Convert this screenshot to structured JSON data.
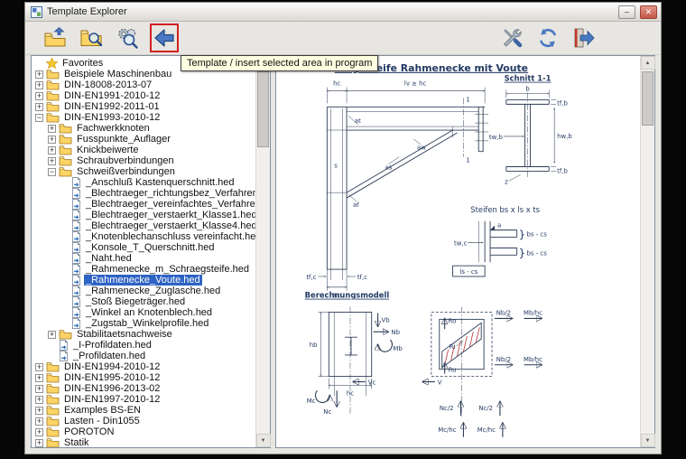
{
  "window": {
    "title": "Template Explorer"
  },
  "titlebar_icons": {
    "minimize": "–",
    "close": "✕"
  },
  "scrollbar_icons": {
    "up": "▲",
    "down": "▼"
  },
  "toolbar": {
    "tooltip": "Template / insert selected area in program",
    "button_names": [
      "open-template",
      "find-template",
      "search-options",
      "insert-template-into-program",
      "settings-tools",
      "refresh",
      "exit"
    ]
  },
  "colors": {
    "selection_blue": "#2e63c4",
    "tooltip_bg": "#ffffe1",
    "highlight_red": "#d22020",
    "drawing_line": "#2b3a55",
    "hatch_red": "#b03030",
    "folder_yellow": "#fcd364"
  },
  "tree": {
    "items": [
      {
        "label": "Favorites",
        "level": 0,
        "icon": "star",
        "toggle": "none"
      },
      {
        "label": "Beispiele Maschinenbau",
        "level": 0,
        "icon": "folder",
        "toggle": "plus"
      },
      {
        "label": "DIN-18008-2013-07",
        "level": 0,
        "icon": "folder",
        "toggle": "plus"
      },
      {
        "label": "DIN-EN1991-2010-12",
        "level": 0,
        "icon": "folder",
        "toggle": "plus"
      },
      {
        "label": "DIN-EN1992-2011-01",
        "level": 0,
        "icon": "folder",
        "toggle": "plus"
      },
      {
        "label": "DIN-EN1993-2010-12",
        "level": 0,
        "icon": "folder",
        "toggle": "minus"
      },
      {
        "label": "Fachwerkknoten",
        "level": 1,
        "icon": "folder",
        "toggle": "plus"
      },
      {
        "label": "Fusspunkte_Auflager",
        "level": 1,
        "icon": "folder",
        "toggle": "plus"
      },
      {
        "label": "Knickbeiwerte",
        "level": 1,
        "icon": "folder",
        "toggle": "plus"
      },
      {
        "label": "Schraubverbindungen",
        "level": 1,
        "icon": "folder",
        "toggle": "plus"
      },
      {
        "label": "Schweißverbindungen",
        "level": 1,
        "icon": "folder",
        "toggle": "minus"
      },
      {
        "label": "_Anschluß Kastenquerschnitt.hed",
        "level": 2,
        "icon": "file",
        "toggle": "none"
      },
      {
        "label": "_Blechtraeger_richtungsbez_Verfahren.hed",
        "level": 2,
        "icon": "file",
        "toggle": "none"
      },
      {
        "label": "_Blechtraeger_vereinfachtes_Verfahren.hed",
        "level": 2,
        "icon": "file",
        "toggle": "none"
      },
      {
        "label": "_Blechtraeger_verstaerkt_Klasse1.hed",
        "level": 2,
        "icon": "file",
        "toggle": "none"
      },
      {
        "label": "_Blechtraeger_verstaerkt_Klasse4.hed",
        "level": 2,
        "icon": "file",
        "toggle": "none"
      },
      {
        "label": "_Knotenblechanschluss vereinfacht.hed",
        "level": 2,
        "icon": "file",
        "toggle": "none"
      },
      {
        "label": "_Konsole_T_Querschnitt.hed",
        "level": 2,
        "icon": "file",
        "toggle": "none"
      },
      {
        "label": "_Naht.hed",
        "level": 2,
        "icon": "file",
        "toggle": "none"
      },
      {
        "label": "_Rahmenecke_m_Schraegsteife.hed",
        "level": 2,
        "icon": "file",
        "toggle": "none"
      },
      {
        "label": "_Rahmenecke_Voute.hed",
        "level": 2,
        "icon": "file",
        "toggle": "none",
        "selected": true
      },
      {
        "label": "_Rahmenecke_Zuglasche.hed",
        "level": 2,
        "icon": "file",
        "toggle": "none"
      },
      {
        "label": "_Stoß Biegeträger.hed",
        "level": 2,
        "icon": "file",
        "toggle": "none"
      },
      {
        "label": "_Winkel an Knotenblech.hed",
        "level": 2,
        "icon": "file",
        "toggle": "none"
      },
      {
        "label": "_Zugstab_Winkelprofile.hed",
        "level": 2,
        "icon": "file",
        "toggle": "none"
      },
      {
        "label": "Stabilitaetsnachweise",
        "level": 1,
        "icon": "folder",
        "toggle": "plus"
      },
      {
        "label": "_I-Profildaten.hed",
        "level": 1,
        "icon": "file",
        "toggle": "none"
      },
      {
        "label": "_Profildaten.hed",
        "level": 1,
        "icon": "file",
        "toggle": "none"
      },
      {
        "label": "DIN-EN1994-2010-12",
        "level": 0,
        "icon": "folder",
        "toggle": "plus"
      },
      {
        "label": "DIN-EN1995-2010-12",
        "level": 0,
        "icon": "folder",
        "toggle": "plus"
      },
      {
        "label": "DIN-EN1996-2013-02",
        "level": 0,
        "icon": "folder",
        "toggle": "plus"
      },
      {
        "label": "DIN-EN1997-2010-12",
        "level": 0,
        "icon": "folder",
        "toggle": "plus"
      },
      {
        "label": "Examples BS-EN",
        "level": 0,
        "icon": "folder",
        "toggle": "plus"
      },
      {
        "label": "Lasten - Din1055",
        "level": 0,
        "icon": "folder",
        "toggle": "plus"
      },
      {
        "label": "POROTON",
        "level": 0,
        "icon": "folder",
        "toggle": "plus"
      },
      {
        "label": "Statik",
        "level": 0,
        "icon": "folder",
        "toggle": "plus"
      }
    ]
  },
  "preview": {
    "title": "Biegesteife Rahmenecke mit Voute",
    "labels": {
      "schnitt": "Schnitt 1-1",
      "steifen": "Steifen bs x ls x ts",
      "modell": "Berechnungsmodell",
      "hc_top": "hc",
      "lv": "lv ≥ hc",
      "tfc_l": "tf,c",
      "hc_bot": "hc",
      "tfc_r": "tf,c",
      "b": "b",
      "tfb_top": "tf,b",
      "hwb": "hw,b",
      "twb": "tw,b",
      "tfb_bot": "tf,b",
      "z": "z",
      "at": "at",
      "as": "as",
      "af": "af",
      "aw": "aw",
      "s": "s",
      "cut_top": "1",
      "cut_bot": "1",
      "twc": "tw,c",
      "a": "a",
      "bscs1": "bs - cs",
      "bscs2": "bs - cs",
      "lscs": "ls - cs",
      "hb": "hb",
      "hc_m": "hc",
      "vb": "Vb",
      "nb": "Nb",
      "mb": "Mb",
      "vc": "Vc",
      "mc": "Mc",
      "nc": "Nc",
      "ro": "Ro",
      "ri": "Ri",
      "ru": "Ru",
      "v": "V",
      "nb2_t": "Nb/2",
      "mbhc_t": "Mb/hc",
      "nb2_b": "Nb/2",
      "mbhc_b": "Mb/hc",
      "nc2_l": "Nc/2",
      "nc2_r": "Nc/2",
      "mchc_l": "Mc/hc",
      "mchc_r": "Mc/hc"
    }
  }
}
